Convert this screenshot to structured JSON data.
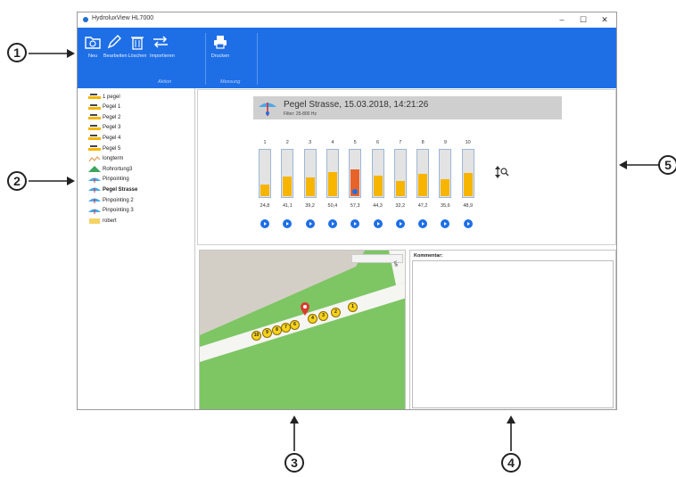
{
  "window": {
    "title": "HydroluxView HL7000",
    "controls": [
      "–",
      "☐",
      "✕"
    ]
  },
  "ribbon": {
    "buttons": [
      {
        "label": "Neu",
        "icon": "new-folder-icon"
      },
      {
        "label": "Bearbeiten",
        "icon": "pencil-icon"
      },
      {
        "label": "Löschen",
        "icon": "trash-icon"
      },
      {
        "label": "Importieren",
        "icon": "transfer-arrows-icon"
      },
      {
        "label": "Drucken",
        "icon": "printer-icon"
      }
    ],
    "groups": [
      "Aktion",
      "Messung"
    ],
    "accent": "#1e6fe6"
  },
  "sidebar": {
    "items": [
      {
        "label": "1 pegel",
        "icon": "pegel-icon"
      },
      {
        "label": "Pegel 1",
        "icon": "pegel-icon"
      },
      {
        "label": "Pegel 2",
        "icon": "pegel-icon"
      },
      {
        "label": "Pegel 3",
        "icon": "pegel-icon"
      },
      {
        "label": "Pegel 4",
        "icon": "pegel-icon"
      },
      {
        "label": "Pegel 5",
        "icon": "pegel-icon"
      },
      {
        "label": "longterm",
        "icon": "longterm-icon"
      },
      {
        "label": "Rohrortung3",
        "icon": "pipe-location-icon"
      },
      {
        "label": "Pinpointing",
        "icon": "pinpointing-icon"
      },
      {
        "label": "Pegel Strasse",
        "icon": "pinpointing-icon",
        "selected": true
      },
      {
        "label": "Pinpointing 2",
        "icon": "pinpointing-icon"
      },
      {
        "label": "Pinpointing 3",
        "icon": "pinpointing-icon"
      },
      {
        "label": "robert",
        "icon": "folder-icon"
      }
    ]
  },
  "measurement": {
    "title": "Pegel Strasse, 15.03.2018, 14:21:26",
    "filter": "Filter: 25-800 Hz",
    "channels": [
      {
        "num": "1",
        "value": "24,8",
        "level": 0.25
      },
      {
        "num": "2",
        "value": "41,1",
        "level": 0.41
      },
      {
        "num": "3",
        "value": "39,2",
        "level": 0.39
      },
      {
        "num": "4",
        "value": "50,4",
        "level": 0.5
      },
      {
        "num": "5",
        "value": "57,3",
        "level": 0.57,
        "highlight": true
      },
      {
        "num": "6",
        "value": "44,3",
        "level": 0.44
      },
      {
        "num": "7",
        "value": "32,2",
        "level": 0.32
      },
      {
        "num": "8",
        "value": "47,2",
        "level": 0.47
      },
      {
        "num": "9",
        "value": "35,6",
        "level": 0.36
      },
      {
        "num": "10",
        "value": "48,9",
        "level": 0.49
      }
    ],
    "colors": {
      "bar": "#f7b500",
      "highlight": "#e8632a"
    }
  },
  "map": {
    "street_label": "ue",
    "markers": [
      "10",
      "9",
      "8",
      "7",
      "6",
      "4",
      "3",
      "2",
      "1"
    ]
  },
  "comment": {
    "label": "Kommentar:"
  },
  "callouts": [
    "1",
    "2",
    "3",
    "4",
    "5"
  ]
}
